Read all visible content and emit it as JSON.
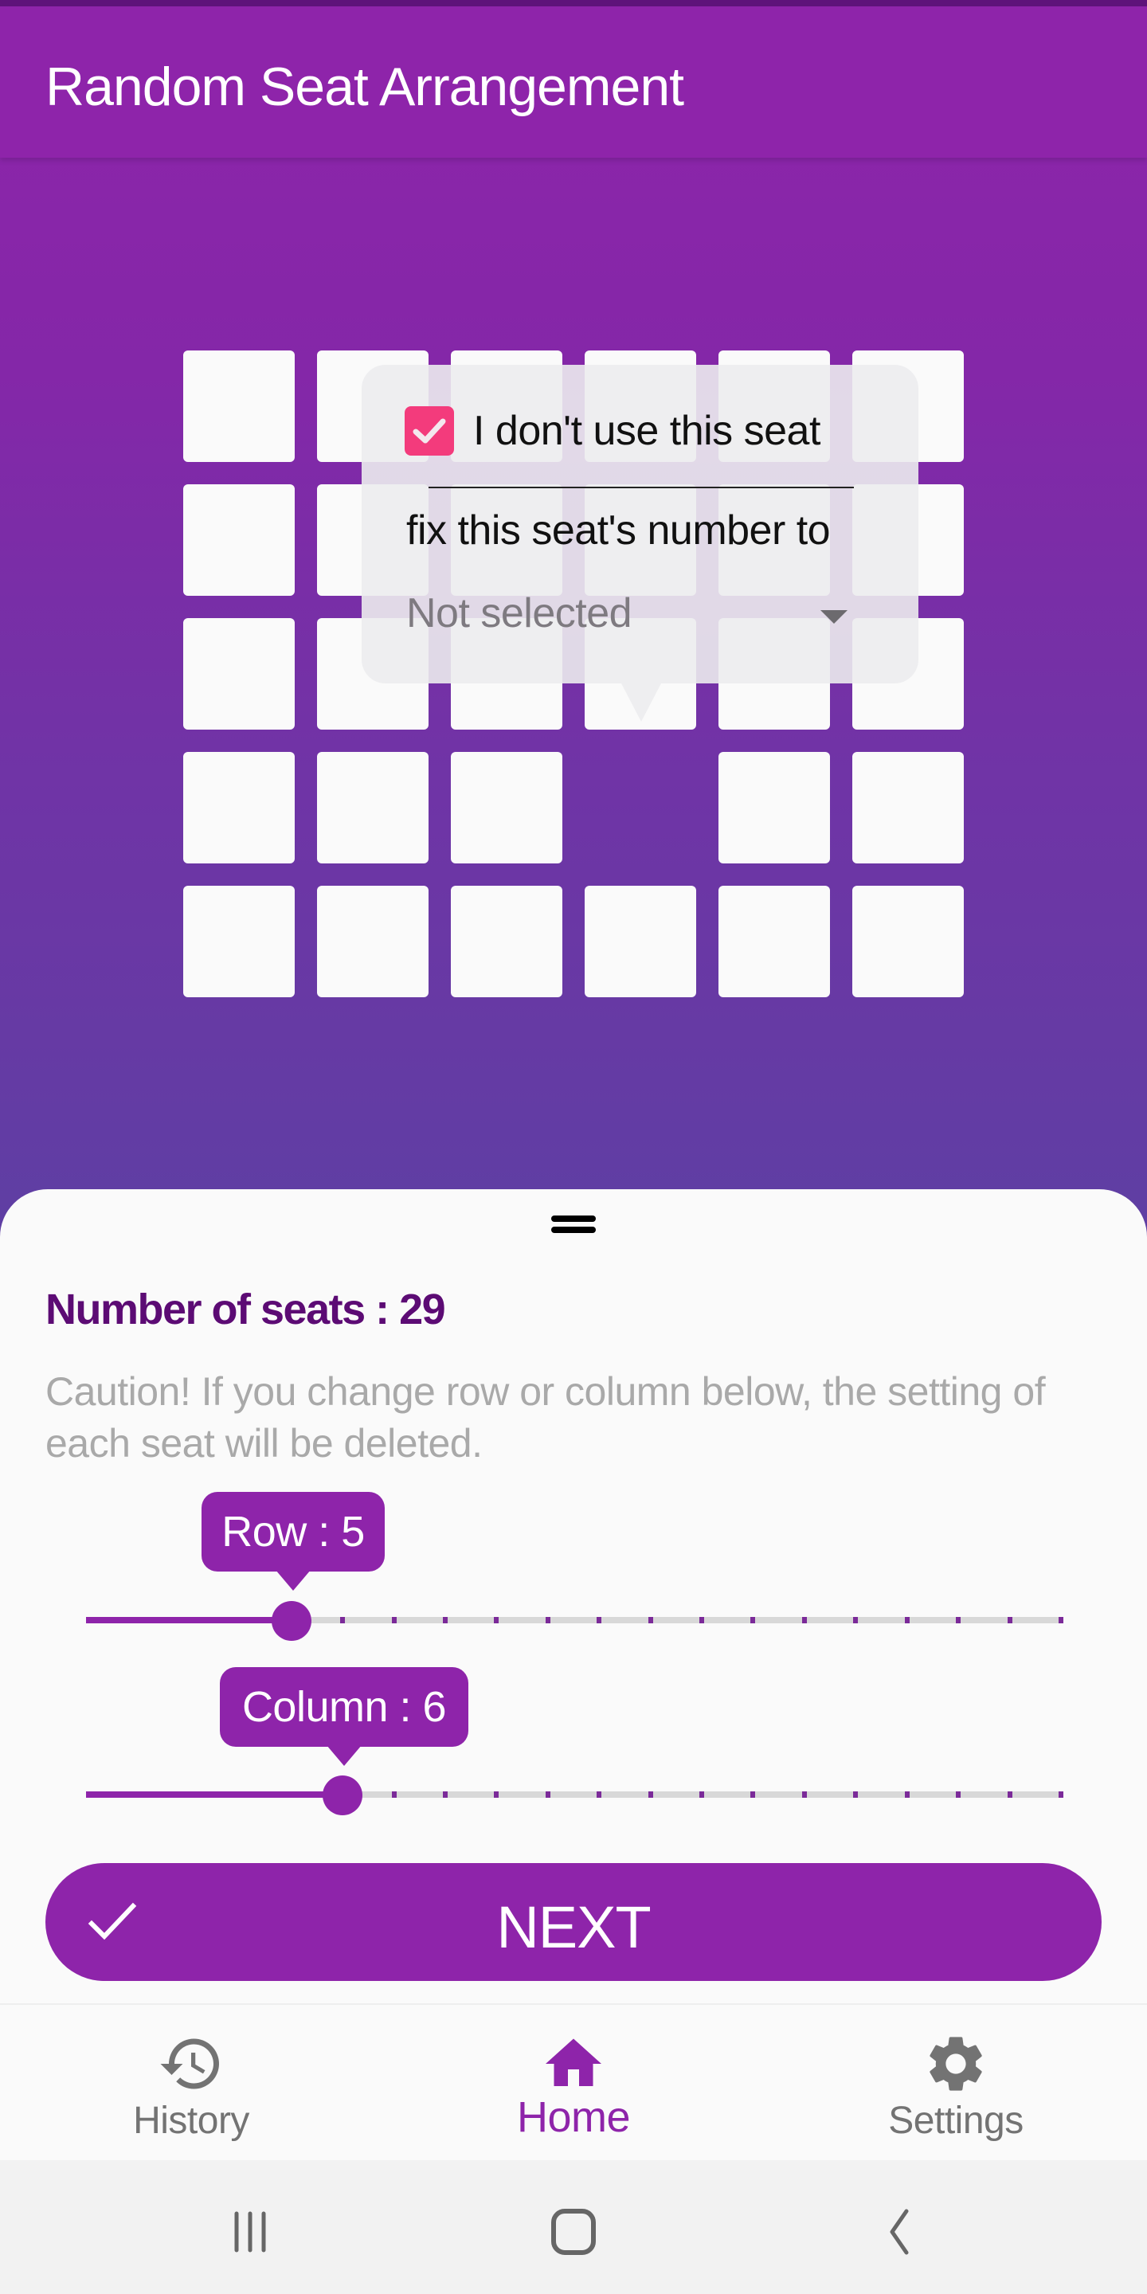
{
  "app": {
    "title": "Random Seat Arrangement",
    "colors": {
      "primary": "#8E24AA",
      "primary_dark": "#5C0B74",
      "checkbox": "#F33B7C",
      "caution_text": "#A9A9A9",
      "inactive_nav": "#737373"
    }
  },
  "seat_grid": {
    "rows": 5,
    "columns": 6,
    "unused_seats": [
      [
        4,
        4
      ]
    ],
    "selected_seat": [
      3,
      4
    ]
  },
  "seat_popup": {
    "unused_checkbox_label": "I don't use this seat",
    "unused_checked": true,
    "fix_number_label": "fix this seat's number to",
    "fix_number_value": "Not selected"
  },
  "sheet": {
    "seat_count_text": "Number of seats : 29",
    "caution_text": "Caution! If you change row or column below, the setting of each seat will be deleted.",
    "row_slider": {
      "label": "Row : 5",
      "value": 5,
      "min": 1,
      "max": 20
    },
    "column_slider": {
      "label": "Column : 6",
      "value": 6,
      "min": 1,
      "max": 20
    },
    "next_button_label": "NEXT",
    "next_button_icon": "check-icon"
  },
  "bottom_nav": {
    "items": [
      {
        "label": "History",
        "icon": "history-icon",
        "active": false
      },
      {
        "label": "Home",
        "icon": "home-icon",
        "active": true
      },
      {
        "label": "Settings",
        "icon": "gear-icon",
        "active": false
      }
    ]
  },
  "system_nav": {
    "buttons": [
      "recent-apps-icon",
      "home-circle-icon",
      "back-icon"
    ]
  }
}
